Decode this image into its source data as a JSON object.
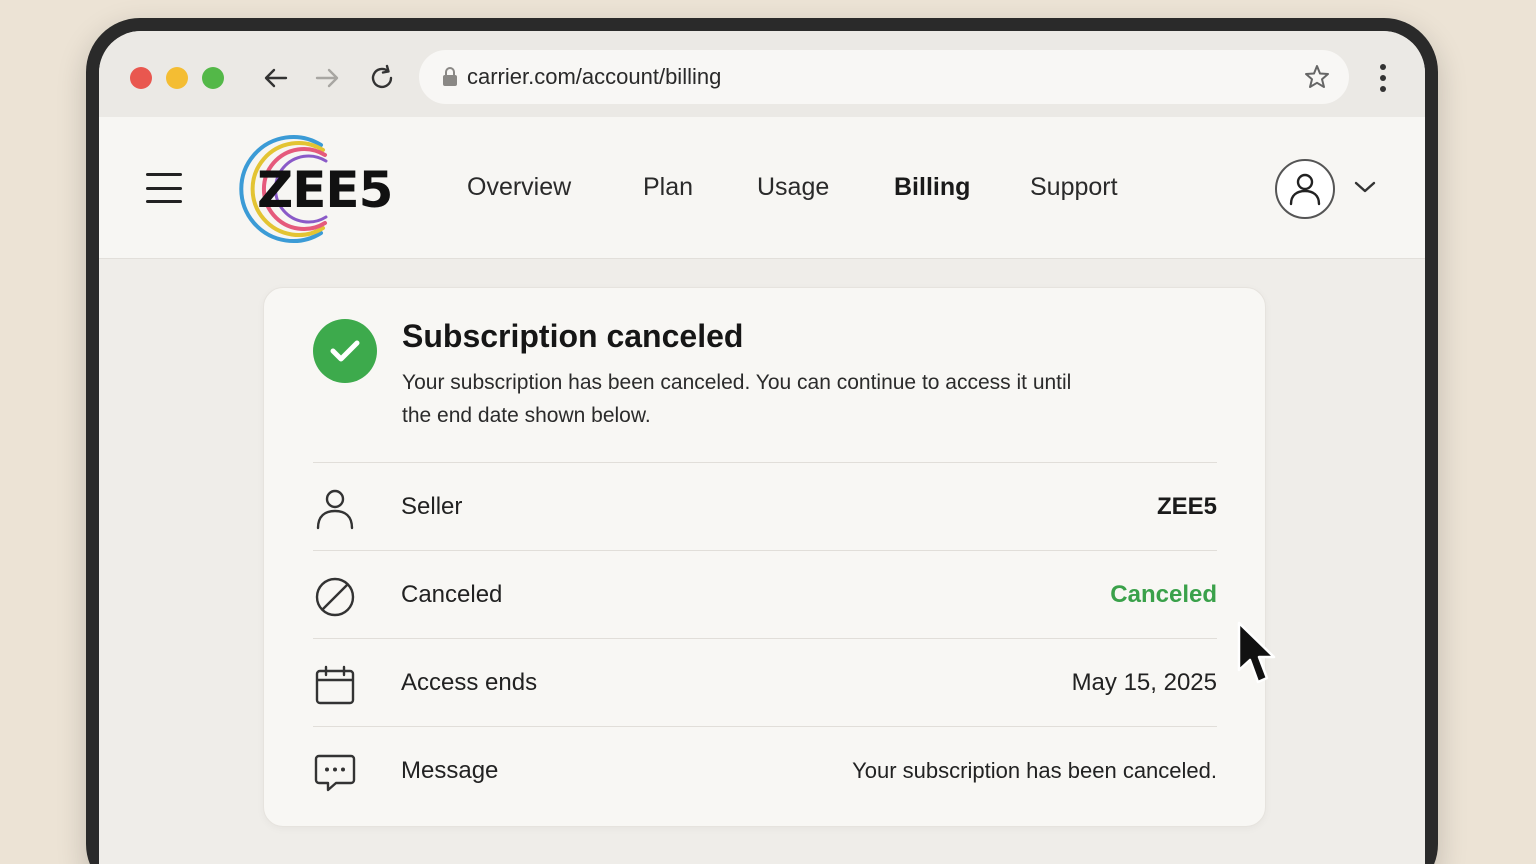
{
  "browser": {
    "url": "carrier.com/account/billing"
  },
  "header": {
    "logo_text": "ZEE5",
    "nav": [
      {
        "label": "Overview",
        "active": false
      },
      {
        "label": "Plan",
        "active": false
      },
      {
        "label": "Usage",
        "active": false
      },
      {
        "label": "Billing",
        "active": true
      },
      {
        "label": "Support",
        "active": false
      }
    ]
  },
  "card": {
    "title": "Subscription canceled",
    "description": "Your subscription has been canceled. You can continue to access it until the end date shown below.",
    "rows": [
      {
        "icon": "person-icon",
        "label": "Seller",
        "value": "ZEE5"
      },
      {
        "icon": "cancel-icon",
        "label": "Canceled",
        "value": "Canceled"
      },
      {
        "icon": "calendar-icon",
        "label": "Access ends",
        "value": "May 15, 2025"
      },
      {
        "icon": "message-icon",
        "label": "Message",
        "value": "Your subscription has been canceled."
      }
    ]
  },
  "colors": {
    "success": "#3daa4c",
    "status_green": "#3aa14a",
    "traffic_red": "#e9574f",
    "traffic_yellow": "#f4bd33",
    "traffic_green": "#53b848"
  }
}
